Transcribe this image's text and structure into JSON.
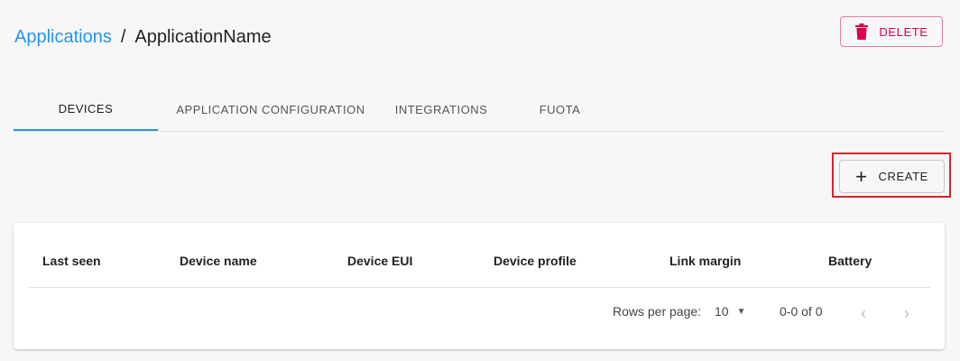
{
  "breadcrumb": {
    "parent": "Applications",
    "separator": "/",
    "current": "ApplicationName"
  },
  "header": {
    "delete_label": "DELETE",
    "delete_icon": "trash-icon"
  },
  "colors": {
    "accent": "#2196f3",
    "danger": "#dc004e",
    "highlight": "#d8232a"
  },
  "tabs": [
    {
      "label": "DEVICES",
      "active": true
    },
    {
      "label": "APPLICATION CONFIGURATION",
      "active": false
    },
    {
      "label": "INTEGRATIONS",
      "active": false
    },
    {
      "label": "FUOTA",
      "active": false
    }
  ],
  "toolbar": {
    "create_label": "CREATE",
    "create_icon": "plus-icon"
  },
  "table": {
    "columns": [
      "Last seen",
      "Device name",
      "Device EUI",
      "Device profile",
      "Link margin",
      "Battery"
    ],
    "rows": []
  },
  "pagination": {
    "rows_per_page_label": "Rows per page:",
    "rows_per_page_value": "10",
    "range": "0-0 of 0"
  }
}
